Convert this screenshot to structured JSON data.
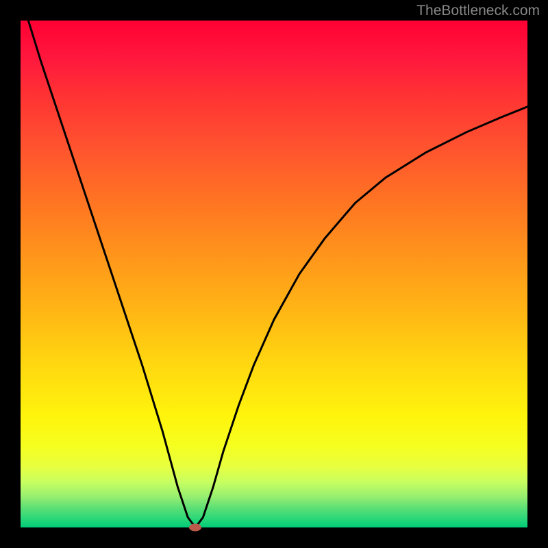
{
  "watermark": "TheBottleneck.com",
  "chart_data": {
    "type": "line",
    "title": "",
    "xlabel": "",
    "ylabel": "",
    "xlim": [
      0,
      100
    ],
    "ylim": [
      0,
      100
    ],
    "grid": false,
    "series": [
      {
        "name": "bottleneck-curve",
        "color": "#000000",
        "x": [
          0,
          4,
          8,
          12,
          16,
          20,
          24,
          28,
          31,
          33,
          34.5,
          36,
          38,
          40,
          43,
          46,
          50,
          55,
          60,
          66,
          72,
          80,
          88,
          95,
          100
        ],
        "values": [
          105,
          92,
          80,
          68,
          56,
          44,
          32,
          19,
          8,
          2,
          0,
          2,
          8,
          15,
          24,
          32,
          41,
          50,
          57,
          64,
          69,
          74,
          78,
          81,
          83
        ]
      }
    ],
    "minimum_point": {
      "x": 34.5,
      "y": 0
    },
    "gradient_zones": [
      {
        "color": "#ff0033",
        "position": 0
      },
      {
        "color": "#ff9a1a",
        "position": 48
      },
      {
        "color": "#fff40c",
        "position": 78
      },
      {
        "color": "#00cc77",
        "position": 100
      }
    ]
  }
}
